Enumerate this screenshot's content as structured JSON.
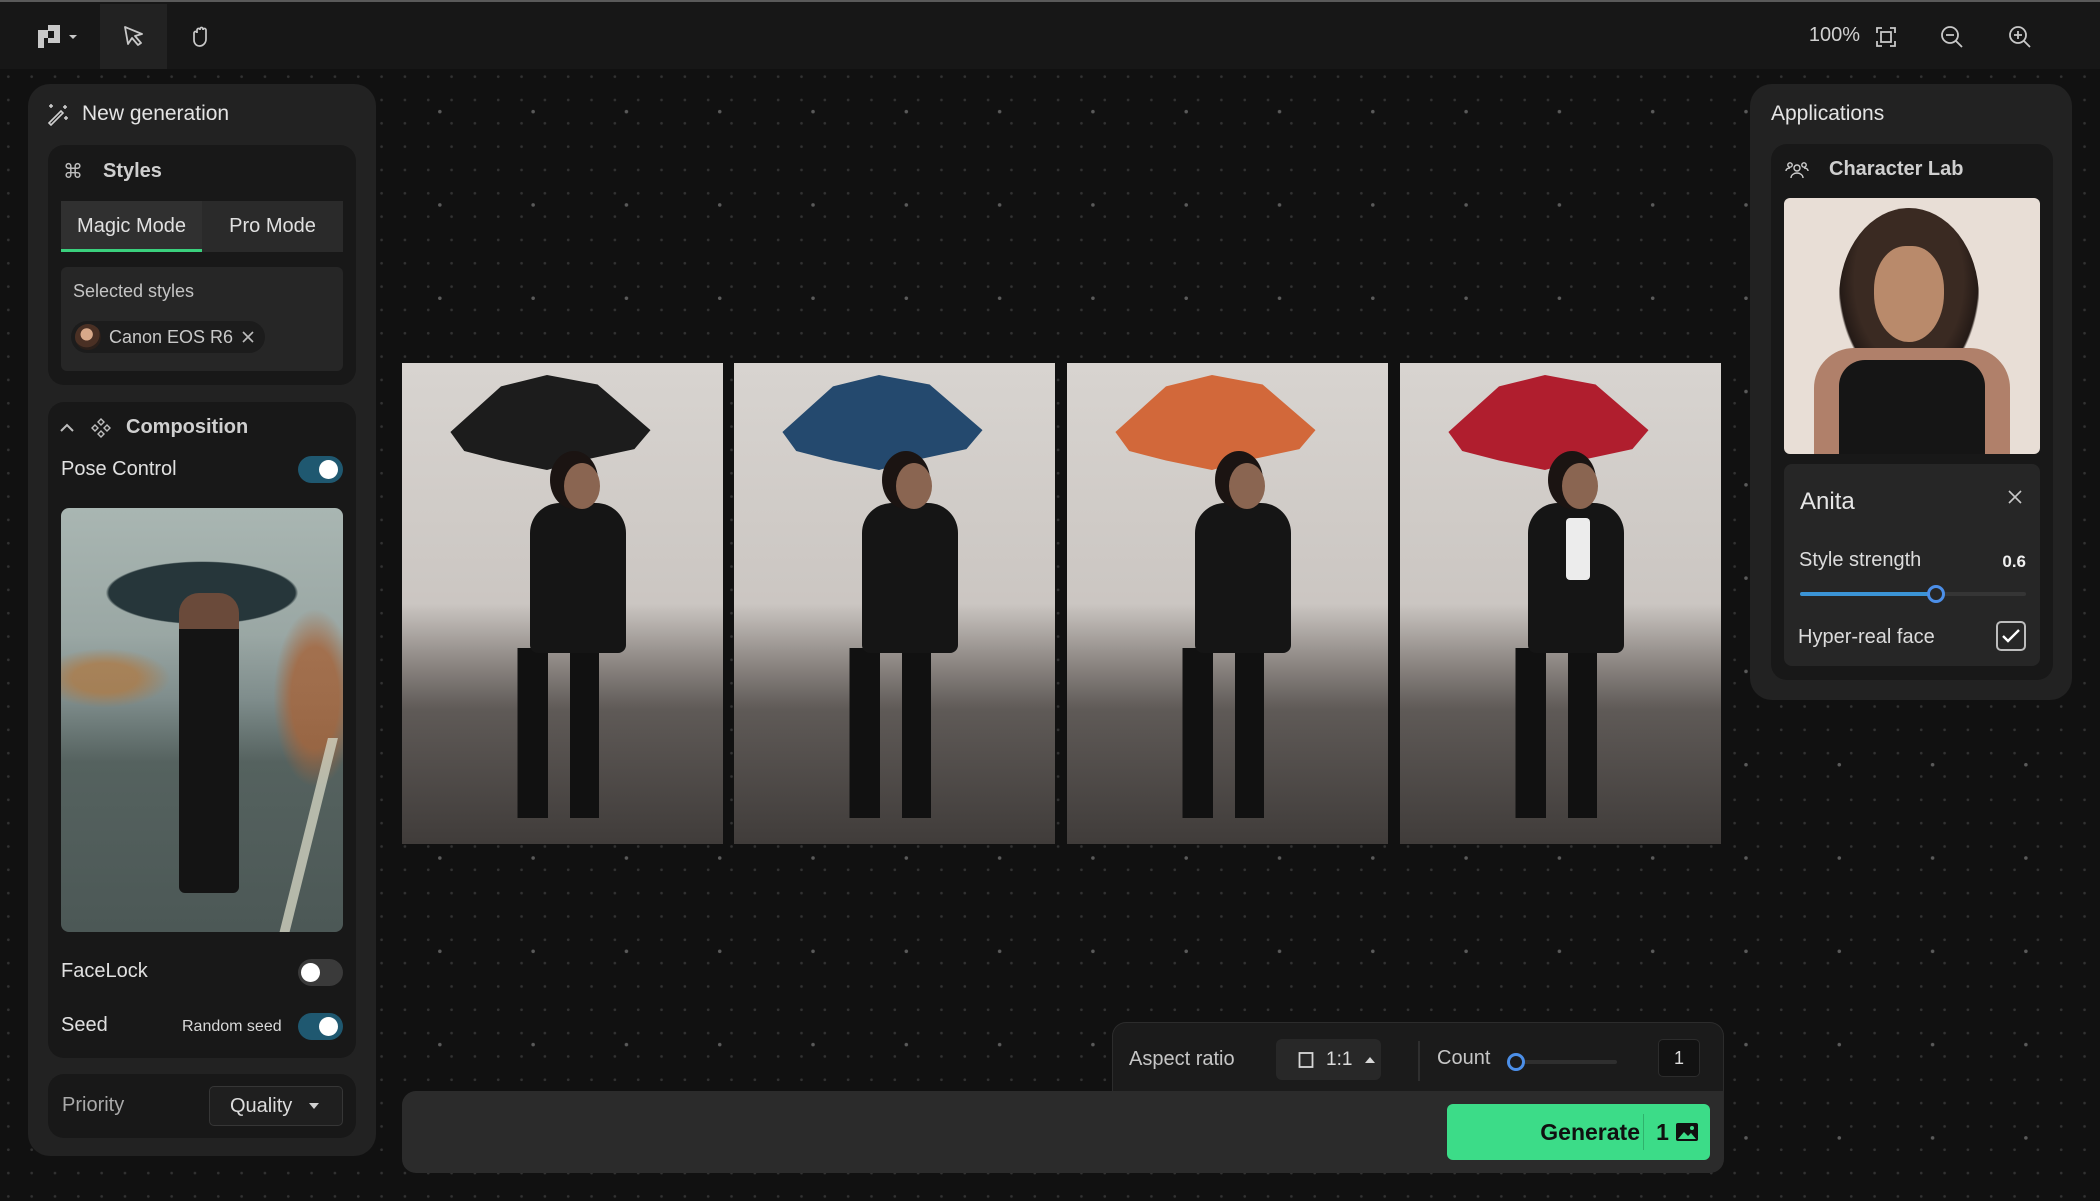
{
  "toolbar": {
    "zoom_level": "100%",
    "tools": [
      "logo-menu",
      "select-tool",
      "hand-tool"
    ],
    "zoom_actions": [
      "fit-to-screen",
      "zoom-out",
      "zoom-in"
    ]
  },
  "left_panel": {
    "title": "New generation",
    "styles": {
      "heading": "Styles",
      "tabs": [
        {
          "label": "Magic Mode",
          "active": true
        },
        {
          "label": "Pro Mode",
          "active": false
        }
      ],
      "selected_label": "Selected styles",
      "selected_chips": [
        {
          "label": "Canon EOS R6"
        }
      ]
    },
    "composition": {
      "heading": "Composition",
      "pose_control": {
        "label": "Pose Control",
        "enabled": true
      },
      "facelock": {
        "label": "FaceLock",
        "enabled": false
      },
      "seed": {
        "label": "Seed",
        "option_label": "Random seed",
        "enabled": true
      }
    },
    "priority": {
      "label": "Priority",
      "value": "Quality"
    }
  },
  "gallery": {
    "images": [
      {
        "description": "woman with black umbrella",
        "umbrella_color": "#1c1c1c",
        "shirt": "black"
      },
      {
        "description": "woman with blue umbrella",
        "umbrella_color": "#24496e",
        "shirt": "black"
      },
      {
        "description": "woman with orange umbrella",
        "umbrella_color": "#d2683a",
        "shirt": "black"
      },
      {
        "description": "woman with red umbrella",
        "umbrella_color": "#b01e2e",
        "shirt": "white"
      }
    ]
  },
  "right_panel": {
    "title": "Applications",
    "character_lab": {
      "heading": "Character Lab",
      "character_name": "Anita",
      "style_strength": {
        "label": "Style strength",
        "value": 0.6,
        "display": "0.6",
        "min": 0,
        "max": 1
      },
      "hyper_real_face": {
        "label": "Hyper-real face",
        "checked": true
      }
    }
  },
  "bottom": {
    "aspect_ratio": {
      "label": "Aspect ratio",
      "value": "1:1"
    },
    "count": {
      "label": "Count",
      "value": "1",
      "slider_fraction": 0
    },
    "prompt": {
      "value": "",
      "placeholder": ""
    },
    "generate": {
      "label": "Generate",
      "count": "1"
    }
  },
  "colors": {
    "accent_green": "#3cdc88",
    "accent_blue": "#4c8fe8",
    "toggle_on": "#1f5870"
  }
}
